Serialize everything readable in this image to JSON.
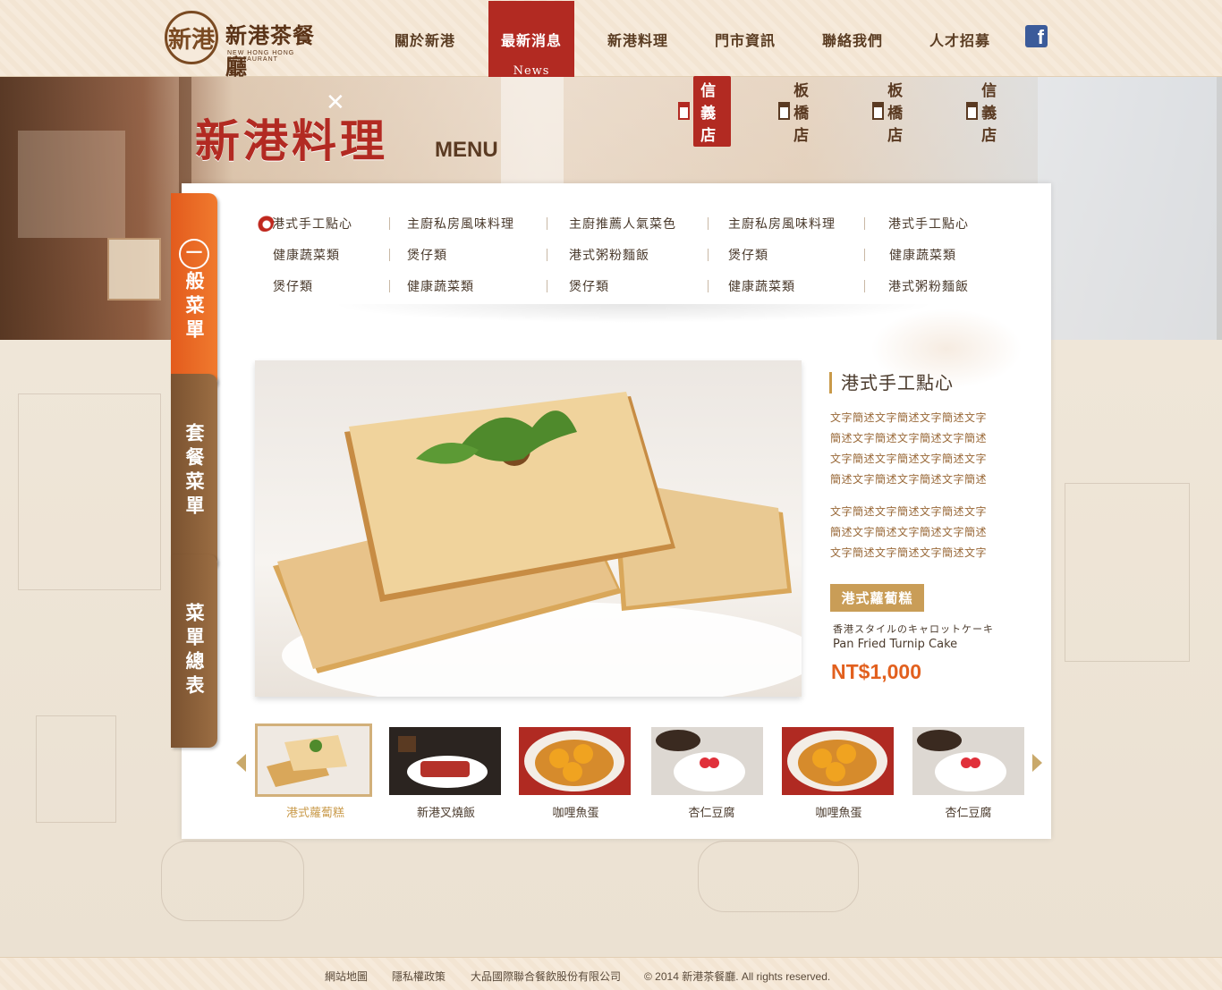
{
  "brand": {
    "seal_text": "新港",
    "name": "新港茶餐廳",
    "name_en": "NEW HONG HONG RESTAURANT"
  },
  "nav": {
    "items": [
      {
        "label": "關於新港"
      },
      {
        "label": "最新消息",
        "sub": "News"
      },
      {
        "label": "新港料理"
      },
      {
        "label": "門市資訊"
      },
      {
        "label": "聯絡我們"
      },
      {
        "label": "人才招募"
      }
    ],
    "active_index": 1,
    "facebook_icon": "facebook-icon"
  },
  "hero": {
    "title": "新港料理",
    "title_en": "MENU",
    "branches": [
      {
        "label": "信義店",
        "active": true
      },
      {
        "label": "板橋店",
        "active": false
      },
      {
        "label": "板橋店",
        "active": false
      },
      {
        "label": "信義店",
        "active": false
      }
    ]
  },
  "side_tabs": [
    {
      "label_top": "一",
      "label": "般菜單"
    },
    {
      "label": "套餐菜單"
    },
    {
      "label": "菜單總表"
    }
  ],
  "categories": [
    [
      "港式手工點心",
      "主廚私房風味料理",
      "主廚推薦人氣菜色",
      "主廚私房風味料理",
      "港式手工點心"
    ],
    [
      "健康蔬菜類",
      "煲仔類",
      "港式粥粉麵飯",
      "煲仔類",
      "健康蔬菜類"
    ],
    [
      "煲仔類",
      "健康蔬菜類",
      "煲仔類",
      "健康蔬菜類",
      "港式粥粉麵飯"
    ]
  ],
  "detail": {
    "title": "港式手工點心",
    "para1": [
      "文字簡述文字簡述文字簡述文字",
      "簡述文字簡述文字簡述文字簡述",
      "文字簡述文字簡述文字簡述文字",
      "簡述文字簡述文字簡述文字簡述"
    ],
    "para2": [
      "文字簡述文字簡述文字簡述文字",
      "簡述文字簡述文字簡述文字簡述",
      "文字簡述文字簡述文字簡述文字"
    ],
    "dish_name": "港式蘿蔔糕",
    "dish_jp": "香港スタイルのキャロットケーキ",
    "dish_en": "Pan Fried Turnip Cake",
    "price": "NT$1,000"
  },
  "thumbs": [
    {
      "label": "港式蘿蔔糕",
      "active": true
    },
    {
      "label": "新港叉燒飯",
      "active": false
    },
    {
      "label": "咖哩魚蛋",
      "active": false
    },
    {
      "label": "杏仁豆腐",
      "active": false
    },
    {
      "label": "咖哩魚蛋",
      "active": false
    },
    {
      "label": "杏仁豆腐",
      "active": false
    }
  ],
  "footer": {
    "links": [
      "網站地圖",
      "隱私權政策",
      "大品國際聯合餐飲股份有限公司"
    ],
    "copyright": "© 2014 新港茶餐廳. All rights reserved."
  }
}
